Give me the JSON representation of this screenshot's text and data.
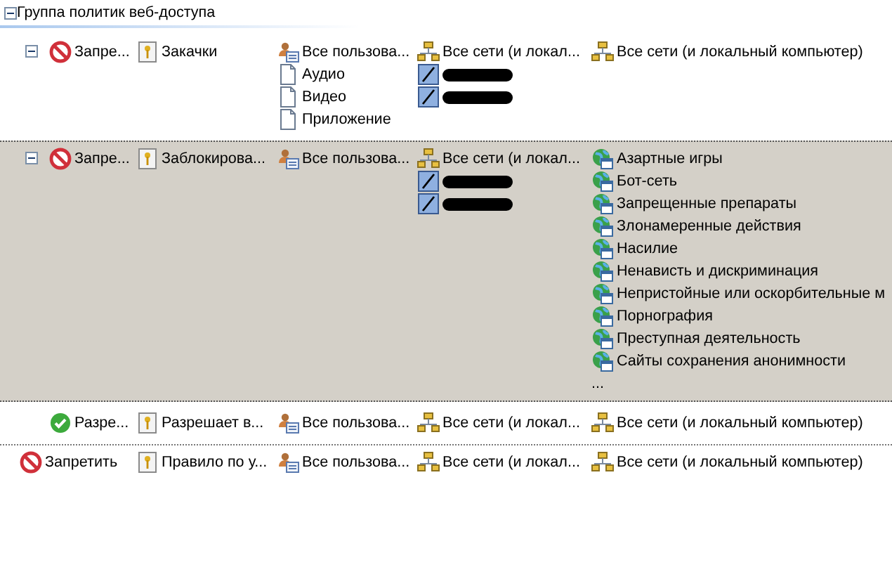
{
  "group": {
    "title": "Группа политик веб-доступа",
    "expanded": true
  },
  "rules": [
    {
      "selected": false,
      "nested": true,
      "expandable": true,
      "action": {
        "kind": "deny",
        "text": "Запре..."
      },
      "name": "Закачки",
      "users": [
        {
          "kind": "users",
          "text": "Все пользова..."
        },
        {
          "kind": "content",
          "text": "Аудио"
        },
        {
          "kind": "content",
          "text": "Видео"
        },
        {
          "kind": "content",
          "text": "Приложение"
        }
      ],
      "sources": [
        {
          "kind": "network",
          "text": "Все сети (и локал..."
        },
        {
          "kind": "redacted"
        },
        {
          "kind": "redacted"
        }
      ],
      "destinations": [
        {
          "kind": "network",
          "text": "Все сети (и локальный компьютер)"
        }
      ]
    },
    {
      "selected": true,
      "nested": true,
      "expandable": true,
      "action": {
        "kind": "deny",
        "text": "Запре..."
      },
      "name": "Заблокирова...",
      "users": [
        {
          "kind": "users",
          "text": "Все пользова..."
        }
      ],
      "sources": [
        {
          "kind": "network",
          "text": "Все сети (и локал..."
        },
        {
          "kind": "redacted"
        },
        {
          "kind": "redacted"
        }
      ],
      "destinations": [
        {
          "kind": "category",
          "text": "Азартные игры"
        },
        {
          "kind": "category",
          "text": "Бот-сеть"
        },
        {
          "kind": "category",
          "text": "Запрещенные препараты"
        },
        {
          "kind": "category",
          "text": "Злонамеренные действия"
        },
        {
          "kind": "category",
          "text": "Насилие"
        },
        {
          "kind": "category",
          "text": "Ненависть и дискриминация"
        },
        {
          "kind": "category",
          "text": "Непристойные или оскорбительные м"
        },
        {
          "kind": "category",
          "text": "Порнография"
        },
        {
          "kind": "category",
          "text": "Преступная деятельность"
        },
        {
          "kind": "category",
          "text": "Сайты сохранения анонимности"
        },
        {
          "kind": "more",
          "text": "..."
        }
      ]
    },
    {
      "selected": false,
      "nested": true,
      "expandable": false,
      "action": {
        "kind": "allow",
        "text": "Разре..."
      },
      "name": "Разрешает в...",
      "users": [
        {
          "kind": "users",
          "text": "Все пользова..."
        }
      ],
      "sources": [
        {
          "kind": "network",
          "text": "Все сети (и локал..."
        }
      ],
      "destinations": [
        {
          "kind": "network",
          "text": "Все сети (и локальный компьютер)"
        }
      ]
    },
    {
      "selected": false,
      "nested": false,
      "expandable": false,
      "action": {
        "kind": "deny",
        "text": "Запретить"
      },
      "name": "Правило по у...",
      "users": [
        {
          "kind": "users",
          "text": "Все пользова..."
        }
      ],
      "sources": [
        {
          "kind": "network",
          "text": "Все сети (и локал..."
        }
      ],
      "destinations": [
        {
          "kind": "network",
          "text": "Все сети (и локальный компьютер)"
        }
      ]
    }
  ]
}
